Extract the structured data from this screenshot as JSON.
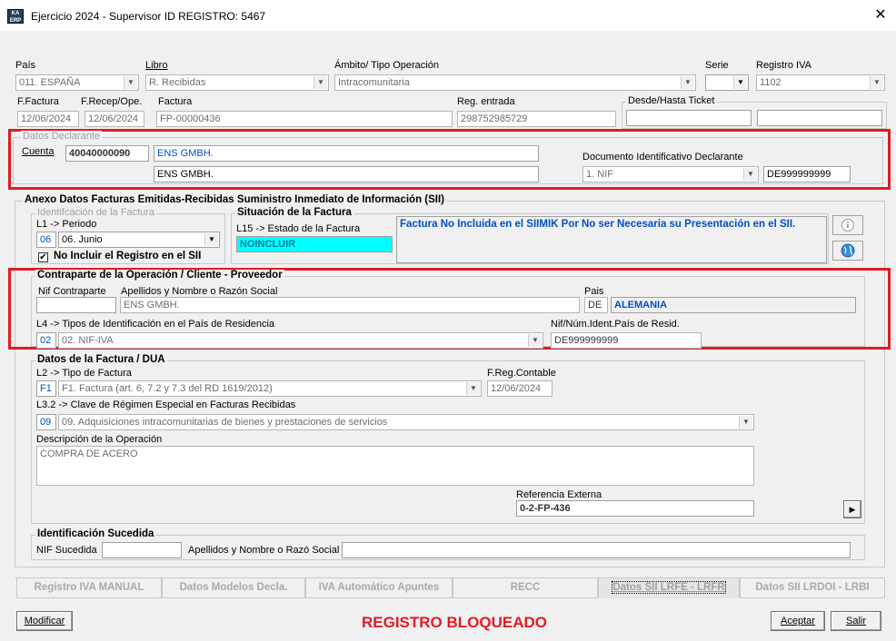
{
  "window": {
    "title": "Ejercicio 2024 - Supervisor ID REGISTRO: 5467",
    "app_icon_text": "KA ERP"
  },
  "header": {
    "pais_label": "País",
    "pais_value": "011.  ESPAÑA",
    "libro_label": "Libro",
    "libro_value": "R. Recibidas",
    "ambito_label": "Ámbito/ Tipo Operación",
    "ambito_value": "Intracomunitaria",
    "serie_label": "Serie",
    "serie_value": "",
    "registro_label": "Registro IVA",
    "registro_value": "1102",
    "ffactura_label": "F.Factura",
    "ffactura_value": "12/06/2024",
    "frecep_label": "F.Recep/Ope.",
    "frecep_value": "12/06/2024",
    "factura_label": "Factura",
    "factura_value": "FP-00000436",
    "regentrada_label": "Reg. entrada",
    "regentrada_value": "298752985729",
    "desde_label": "Desde/Hasta Ticket"
  },
  "declarante": {
    "legend": "Datos Declarante",
    "cuenta_label": "Cuenta",
    "cuenta_value": "40040000090",
    "nombre_blue": "ENS GMBH.",
    "nombre": "ENS GMBH.",
    "doc_label": "Documento Identificativo Declarante",
    "doc_value": "1. NIF",
    "doc_num": "DE999999999"
  },
  "anexo": {
    "legend": "Anexo Datos Facturas Emitidas-Recibidas Suministro Inmediato de Información (SII)",
    "ident": {
      "legend": "Identifcación de la Factura",
      "periodo_label": "L1 -> Periodo",
      "periodo_code": "06",
      "periodo_value": "06. Junio",
      "no_incluir_label": "No Incluir el Registro en el SII",
      "check_mark": "✔"
    },
    "situacion": {
      "legend": "Situación de la Factura",
      "estado_label": "L15 -> Estado de la Factura",
      "estado_value": "NOINCLUIR",
      "mensaje": "Factura No Incluida en el SIIMIK Por No ser Necesaria su Presentación en el SII."
    },
    "contraparte": {
      "legend": "Contraparte de la Operación / Cliente - Proveedor",
      "nif_label": "Nif Contraparte",
      "nif_value": "",
      "nombre_label": "Apellidos y Nombre o Razón Social",
      "nombre_value": "ENS GMBH.",
      "pais_label": "Pais",
      "pais_code": "DE",
      "pais_value": "ALEMANIA",
      "tipos_label": "L4 -> Tipos de Identificación en el País de Residencia",
      "tipos_code": "02",
      "tipos_value": "02. NIF-IVA",
      "nifres_label": "Nif/Núm.Ident.País de Resid.",
      "nifres_value": "DE999999999"
    },
    "datos_factura": {
      "legend": "Datos de la Factura / DUA",
      "tipo_label": "L2 -> Tipo de Factura",
      "tipo_code": "F1",
      "tipo_value": "F1. Factura (art. 6, 7.2 y 7.3 del RD 1619/2012)",
      "freg_label": "F.Reg.Contable",
      "freg_value": "12/06/2024",
      "clave_label": "L3.2 -> Clave de Régimen Especial en Facturas Recibidas",
      "clave_code": "09",
      "clave_value": "09. Adquisiciones intracomunitarias de bienes y prestaciones de servicios",
      "desc_label": "Descripción de la Operación",
      "desc_value": "COMPRA DE ACERO",
      "ref_label": "Referencia Externa",
      "ref_value": "0-2-FP-436",
      "arrow": "▶"
    },
    "sucedida": {
      "legend": "Identificación Sucedida",
      "nif_label": "NIF Sucedida",
      "nombre_label": "Apellidos y Nombre o Razó Social"
    }
  },
  "tabs": [
    "Registro IVA MANUAL",
    "Datos Modelos Decla.",
    "IVA Automático Apuntes",
    "RECC",
    "Datos SII  LRFE - LRFR",
    "Datos SII LRDOI - LRBI"
  ],
  "footer": {
    "modificar": "Modificar",
    "status": "REGISTRO BLOQUEADO",
    "aceptar": "Aceptar",
    "salir": "Salir"
  },
  "icons": {
    "close": "close-icon",
    "info": "info-icon",
    "globe": "globe-icon",
    "dropdown": "chevron-down-icon"
  }
}
